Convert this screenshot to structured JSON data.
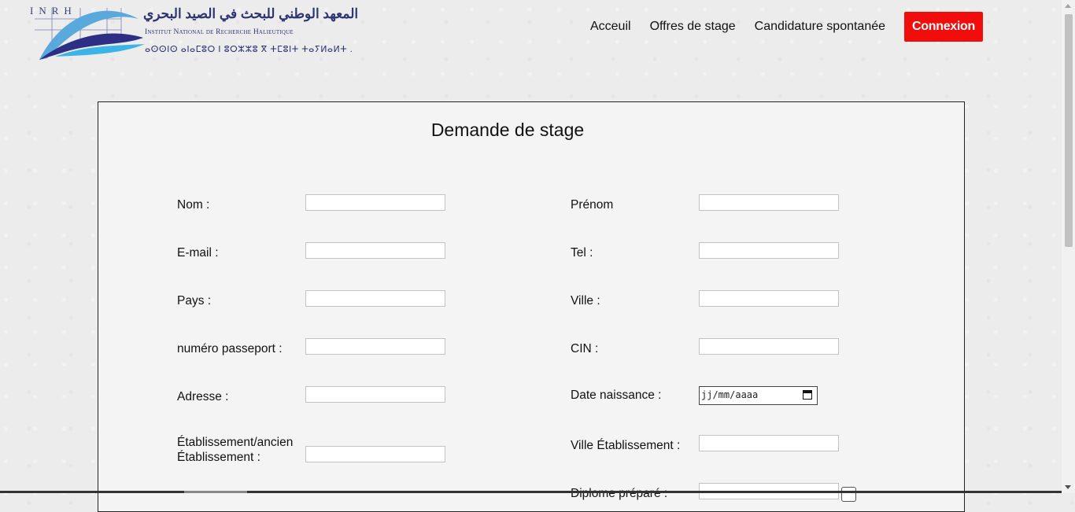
{
  "logo": {
    "inrh": "INRH",
    "arabic": "المعهد الوطني للبحث في الصيد البحري",
    "latin": "Institut National de Recherche Halieutique",
    "tifinagh": "ⴰⵙⵙⵏⵙ ⴰⵏⴰⵎⵓⵔ ⵏ ⵓⵔⵣⵣⵓ ⴳ ⵜⵎⵓⵏⵜ ⵜⴰⵢⵍⴰⵍⵜ ."
  },
  "nav": {
    "items": [
      "Acceuil",
      "Offres de stage",
      "Candidature spontanée"
    ],
    "login_label": "Connexion",
    "login_color": "#f20d0d"
  },
  "form": {
    "title": "Demande de stage",
    "left_labels": [
      "Nom :",
      "E-mail :",
      "Pays :",
      "numéro passeport :",
      "Adresse :",
      "Établissement/ancien Établissement :"
    ],
    "right_labels": [
      "Prénom",
      "Tel :",
      "Ville :",
      "CIN :",
      "Date naissance :",
      "Ville Établissement :",
      "Diplome préparé :"
    ],
    "date_placeholder": "jj/mm/aaaa"
  }
}
